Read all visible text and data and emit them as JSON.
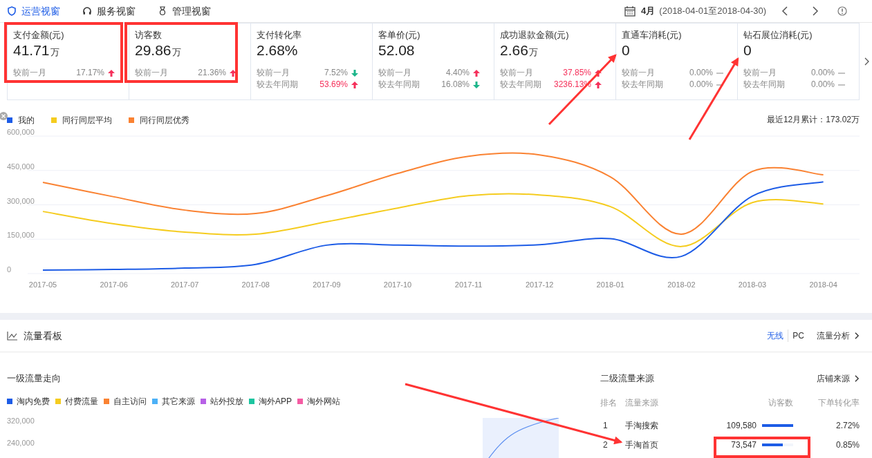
{
  "tabs": [
    {
      "label": "运营视窗",
      "selected": true
    },
    {
      "label": "服务视窗",
      "selected": false
    },
    {
      "label": "管理视窗",
      "selected": false
    }
  ],
  "period": {
    "month": "4月",
    "range": "(2018-04-01至2018-04-30)"
  },
  "metrics": [
    {
      "title": "支付金额(元)",
      "value": "41.71",
      "unit": "万",
      "comparisons": [
        {
          "label": "较前一月",
          "value": "17.17%",
          "highlight": false,
          "kind": "up"
        }
      ]
    },
    {
      "title": "访客数",
      "value": "29.86",
      "unit": "万",
      "comparisons": [
        {
          "label": "较前一月",
          "value": "21.36%",
          "highlight": false,
          "kind": "up"
        }
      ]
    },
    {
      "title": "支付转化率",
      "value": "2.68%",
      "comparisons": [
        {
          "label": "较前一月",
          "value": "7.52%",
          "highlight": false,
          "kind": "down"
        },
        {
          "label": "较去年同期",
          "value": "53.69%",
          "highlight": true,
          "kind": "up"
        }
      ]
    },
    {
      "title": "客单价(元)",
      "value": "52.08",
      "comparisons": [
        {
          "label": "较前一月",
          "value": "4.40%",
          "highlight": false,
          "kind": "up"
        },
        {
          "label": "较去年同期",
          "value": "16.08%",
          "highlight": false,
          "kind": "down"
        }
      ]
    },
    {
      "title": "成功退款金额(元)",
      "value": "2.66",
      "unit": "万",
      "comparisons": [
        {
          "label": "较前一月",
          "value": "37.85%",
          "highlight": true,
          "kind": "up"
        },
        {
          "label": "较去年同期",
          "value": "3236.13%",
          "highlight": true,
          "kind": "up"
        }
      ]
    },
    {
      "title": "直通车消耗(元)",
      "value": "0",
      "comparisons": [
        {
          "label": "较前一月",
          "value": "0.00%",
          "highlight": false,
          "kind": "flat"
        },
        {
          "label": "较去年同期",
          "value": "0.00%",
          "highlight": false,
          "kind": "flat"
        }
      ]
    },
    {
      "title": "钻石展位消耗(元)",
      "value": "0",
      "comparisons": [
        {
          "label": "较前一月",
          "value": "0.00%",
          "highlight": false,
          "kind": "flat"
        },
        {
          "label": "较去年同期",
          "value": "0.00%",
          "highlight": false,
          "kind": "flat"
        }
      ]
    }
  ],
  "trend_chart": {
    "total": "最近12月累计：173.02万",
    "chart_data": {
      "type": "line",
      "categories": [
        "2017-05",
        "2017-06",
        "2017-07",
        "2017-08",
        "2017-09",
        "2017-10",
        "2017-11",
        "2017-12",
        "2018-01",
        "2018-02",
        "2018-03",
        "2018-04"
      ],
      "ylim": [
        0,
        600000
      ],
      "grid": true,
      "yticks": [
        {
          "value": 0,
          "label": "0"
        },
        {
          "value": 150000,
          "label": "150,000"
        },
        {
          "value": 300000,
          "label": "300,000"
        },
        {
          "value": 450000,
          "label": "450,000"
        },
        {
          "value": 600000,
          "label": "600,000"
        }
      ],
      "series": [
        {
          "name": "我的",
          "color": "#1d5ce6",
          "values": [
            15000,
            18000,
            24000,
            40000,
            124000,
            124000,
            120000,
            126000,
            152000,
            75000,
            338000,
            400000
          ]
        },
        {
          "name": "同行同层平均",
          "color": "#f5cc1f",
          "values": [
            271000,
            217000,
            181000,
            172000,
            226000,
            286000,
            340000,
            343000,
            292000,
            118000,
            310000,
            304000
          ]
        },
        {
          "name": "同行同层优秀",
          "color": "#fa8232",
          "values": [
            398000,
            335000,
            277000,
            262000,
            340000,
            437000,
            512000,
            518000,
            422000,
            172000,
            446000,
            431000
          ]
        }
      ]
    }
  },
  "traffic": {
    "title": "流量看板",
    "switches": [
      {
        "label": "无线",
        "selected": true
      },
      {
        "label": "PC",
        "selected": false
      }
    ],
    "link": "流量分析",
    "primary": {
      "title": "一级流量走向",
      "legend": [
        {
          "label": "淘内免费",
          "color": "#1d5ce6"
        },
        {
          "label": "付费流量",
          "color": "#f5cc1f"
        },
        {
          "label": "自主访问",
          "color": "#fa8232"
        },
        {
          "label": "其它来源",
          "color": "#4cb1f7"
        },
        {
          "label": "站外投放",
          "color": "#b760e6"
        },
        {
          "label": "淘外APP",
          "color": "#1cc5a0"
        },
        {
          "label": "淘外网站",
          "color": "#f55ba3"
        }
      ],
      "y_axis_labels": [
        "320,000",
        "240,000"
      ]
    },
    "secondary": {
      "title": "二级流量来源",
      "link": "店铺来源",
      "columns": [
        "排名",
        "流量来源",
        "访客数",
        "下单转化率"
      ],
      "rows": [
        {
          "rank": "1",
          "source": "手淘搜索",
          "visitors": "109,580",
          "level": 1,
          "rate": "2.72%"
        },
        {
          "rank": "2",
          "source": "手淘首页",
          "visitors": "73,547",
          "level": 0.67,
          "rate": "0.85%"
        }
      ]
    }
  }
}
